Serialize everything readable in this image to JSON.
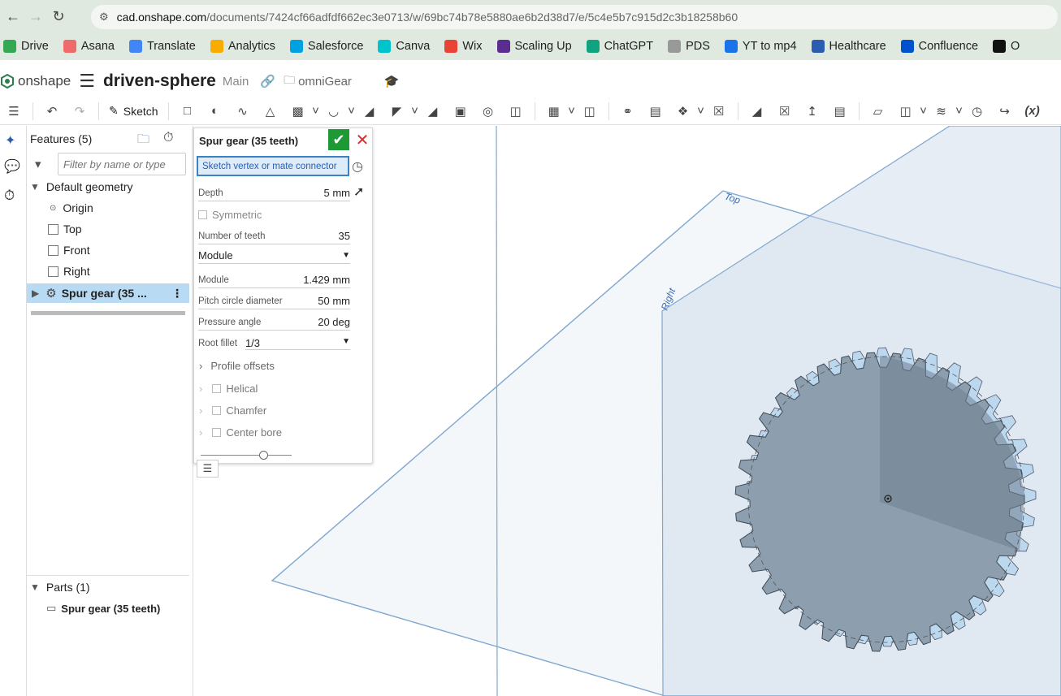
{
  "browser": {
    "url_host": "cad.onshape.com",
    "url_path": "/documents/7424cf66adfdf662ec3e0713/w/69bc74b78e5880ae6b2d38d7/e/5c4e5b7c915d2c3b18258b60"
  },
  "bookmarks": [
    {
      "label": "Drive",
      "color": "#34a853"
    },
    {
      "label": "Asana",
      "color": "#f06a6a"
    },
    {
      "label": "Translate",
      "color": "#4285f4"
    },
    {
      "label": "Analytics",
      "color": "#f9ab00"
    },
    {
      "label": "Salesforce",
      "color": "#00a1e0"
    },
    {
      "label": "Canva",
      "color": "#00c4cc"
    },
    {
      "label": "Wix",
      "color": "#ea4335"
    },
    {
      "label": "Scaling Up",
      "color": "#5b2d90"
    },
    {
      "label": "ChatGPT",
      "color": "#10a37f"
    },
    {
      "label": "PDS",
      "color": "#999999"
    },
    {
      "label": "YT to mp4",
      "color": "#1a73e8"
    },
    {
      "label": "Healthcare",
      "color": "#2a5db0"
    },
    {
      "label": "Confluence",
      "color": "#0052cc"
    },
    {
      "label": "O",
      "color": "#111111"
    }
  ],
  "app": {
    "logo_text": "onshape",
    "doc_title": "driven-sphere",
    "branch": "Main",
    "folder": "omniGear"
  },
  "toolbar": {
    "sketch_label": "Sketch"
  },
  "features": {
    "header": "Features (5)",
    "filter_placeholder": "Filter by name or type",
    "default_geometry": "Default geometry",
    "origin": "Origin",
    "top": "Top",
    "front": "Front",
    "right": "Right",
    "spur_gear": "Spur gear (35 ..."
  },
  "parts": {
    "header": "Parts (1)",
    "item": "Spur gear (35 teeth)"
  },
  "dialog": {
    "title": "Spur gear (35 teeth)",
    "selector_placeholder": "Sketch vertex or mate connector",
    "depth_label": "Depth",
    "depth_value": "5 mm",
    "symmetric_label": "Symmetric",
    "teeth_label": "Number of teeth",
    "teeth_value": "35",
    "mode_value": "Module",
    "module_label": "Module",
    "module_value": "1.429 mm",
    "pcd_label": "Pitch circle diameter",
    "pcd_value": "50 mm",
    "pressure_label": "Pressure angle",
    "pressure_value": "20 deg",
    "root_fillet_label": "Root fillet",
    "root_fillet_value": "1/3",
    "profile_offsets": "Profile offsets",
    "helical": "Helical",
    "chamfer": "Chamfer",
    "center_bore": "Center bore"
  },
  "viewport": {
    "plane_top_label": "Top",
    "plane_right_label": "Right"
  }
}
